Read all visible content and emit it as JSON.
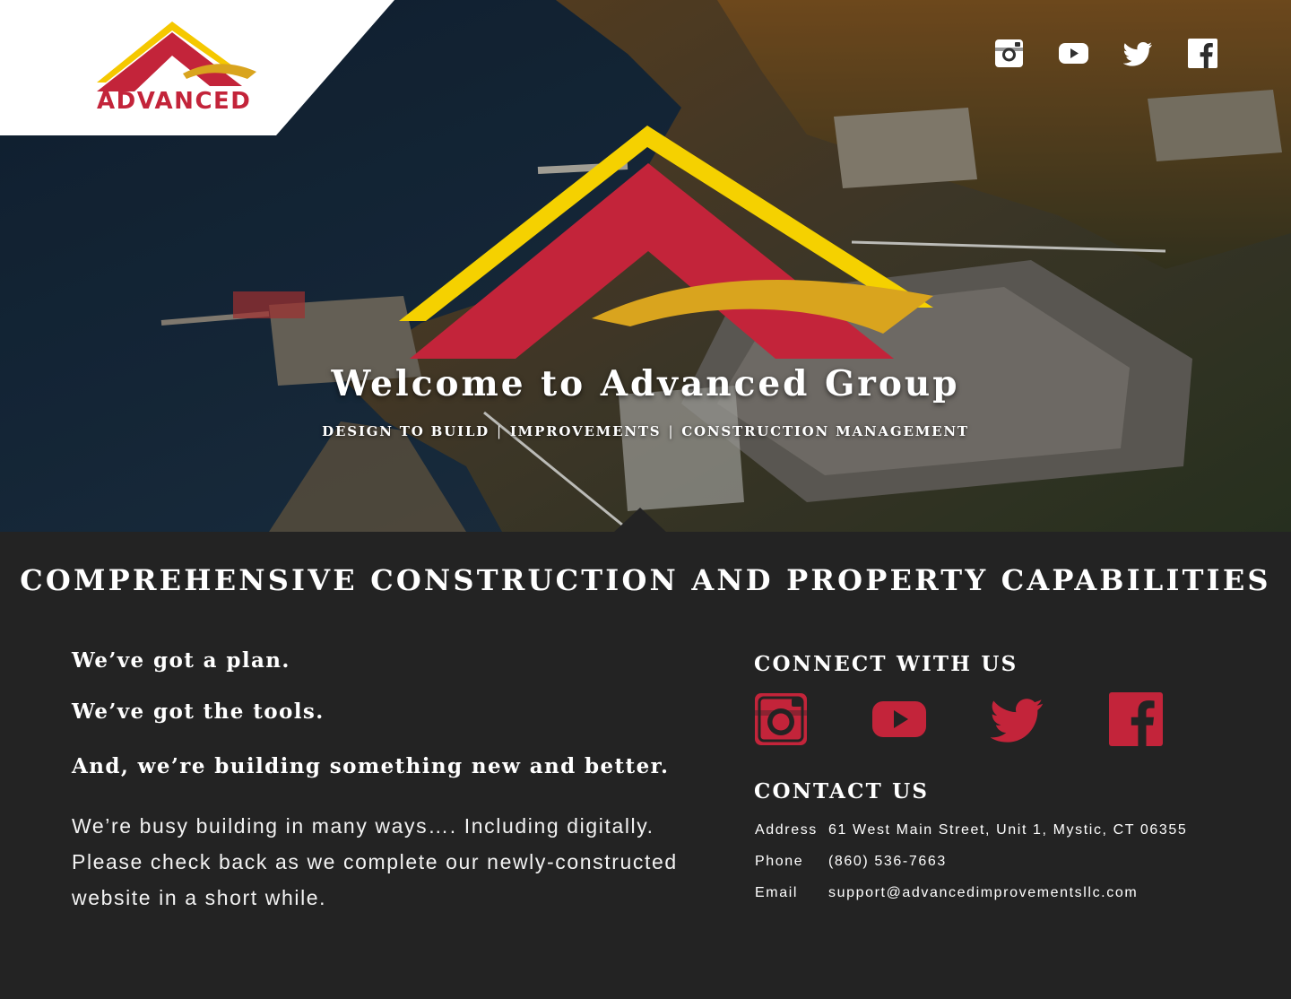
{
  "brand": {
    "logo_text": "ADVANCED",
    "red": "#c3243a",
    "yellow": "#f5c800",
    "gold": "#d9a41e"
  },
  "header": {
    "social": [
      {
        "icon": "instagram-icon"
      },
      {
        "icon": "youtube-icon"
      },
      {
        "icon": "twitter-icon"
      },
      {
        "icon": "facebook-icon"
      }
    ]
  },
  "hero": {
    "title": "Welcome to Advanced Group",
    "services": [
      "DESIGN TO BUILD",
      "IMPROVEMENTS",
      "CONSTRUCTION MANAGEMENT"
    ],
    "separator": "|"
  },
  "main": {
    "section_title": "COMPREHENSIVE CONSTRUCTION AND PROPERTY CAPABILITIES",
    "headline1": "We’ve got a plan.",
    "headline2": "We’ve got the tools.",
    "headline3": "And, we’re building something new and better.",
    "body": "We’re busy building in many ways…. Including digitally. Please check back as we complete our newly-constructed website in a short while."
  },
  "connect": {
    "title": "CONNECT WITH US",
    "icons": [
      "instagram-icon",
      "youtube-icon",
      "twitter-icon",
      "facebook-icon"
    ]
  },
  "contact": {
    "title": "CONTACT US",
    "address_label": "Address",
    "address": "61 West Main Street, Unit 1, Mystic, CT 06355",
    "phone_label": "Phone",
    "phone": "(860) 536-7663",
    "email_label": "Email",
    "email": "support@advancedimprovementsllc.com"
  }
}
